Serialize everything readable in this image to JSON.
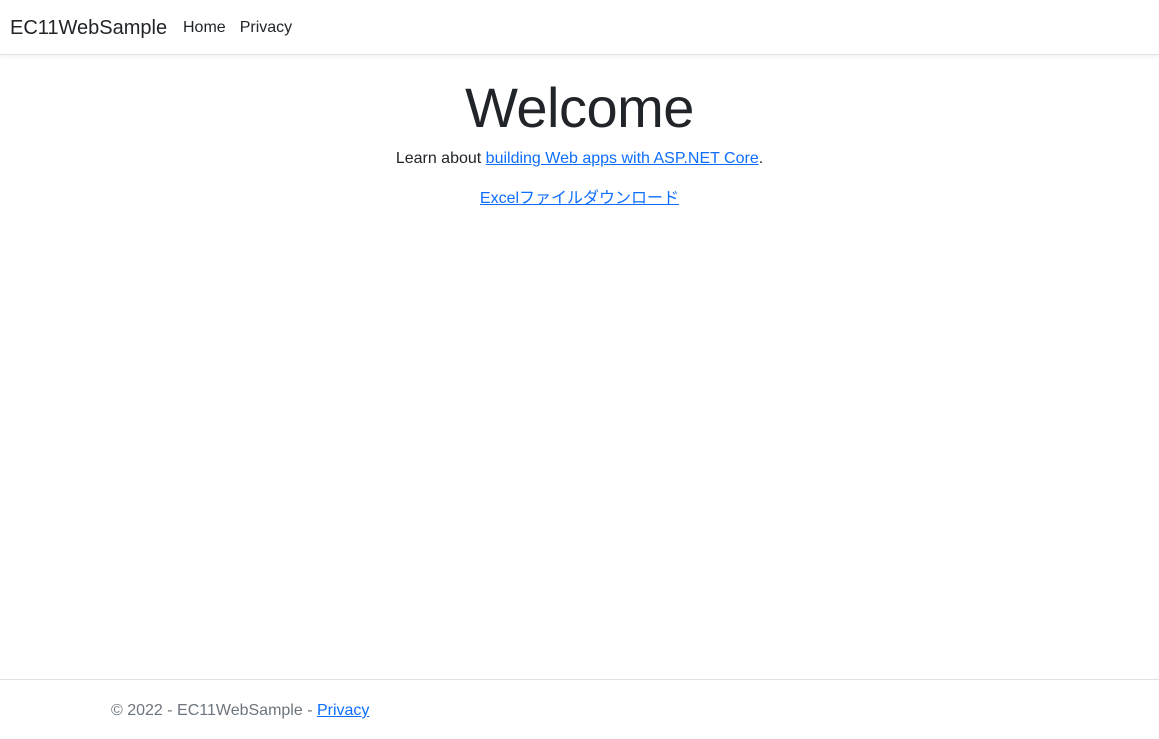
{
  "navbar": {
    "brand": "EC11WebSample",
    "links": [
      {
        "label": "Home"
      },
      {
        "label": "Privacy"
      }
    ]
  },
  "main": {
    "heading": "Welcome",
    "intro_prefix": "Learn about ",
    "intro_link": "building Web apps with ASP.NET Core",
    "intro_suffix": ".",
    "download_link": "Excelファイルダウンロード"
  },
  "footer": {
    "copyright": "© 2022 - EC11WebSample - ",
    "privacy_link": "Privacy"
  },
  "colors": {
    "link": "#0d6efd",
    "text": "#212529",
    "muted": "#6c757d",
    "border": "#dee2e6"
  }
}
